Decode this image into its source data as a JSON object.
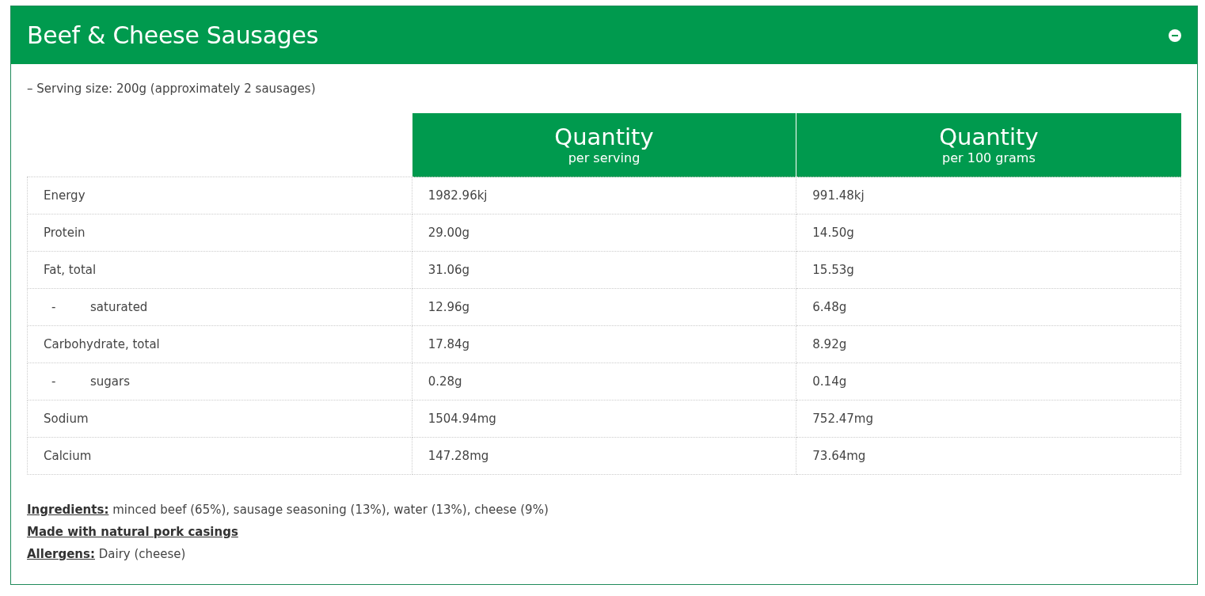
{
  "panel": {
    "title": "Beef & Cheese Sausages",
    "expanded": true
  },
  "serving": "– Serving size: 200g (approximately 2 sausages)",
  "table": {
    "columns": [
      {
        "heading": "Quantity",
        "subheading": "per serving"
      },
      {
        "heading": "Quantity",
        "subheading": "per 100 grams"
      }
    ],
    "rows": [
      {
        "kind": "main",
        "label": "Energy",
        "values": [
          "1982.96kj",
          "991.48kj"
        ]
      },
      {
        "kind": "main",
        "label": "Protein",
        "values": [
          "29.00g",
          "14.50g"
        ]
      },
      {
        "kind": "main",
        "label": "Fat, total",
        "values": [
          "31.06g",
          "15.53g"
        ]
      },
      {
        "kind": "sub",
        "dash": "-",
        "label": "saturated",
        "values": [
          "12.96g",
          "6.48g"
        ]
      },
      {
        "kind": "main",
        "label": "Carbohydrate, total",
        "values": [
          "17.84g",
          "8.92g"
        ]
      },
      {
        "kind": "sub",
        "dash": "-",
        "label": "sugars",
        "values": [
          "0.28g",
          "0.14g"
        ]
      },
      {
        "kind": "main",
        "label": "Sodium",
        "values": [
          "1504.94mg",
          "752.47mg"
        ]
      },
      {
        "kind": "main",
        "label": "Calcium",
        "values": [
          "147.28mg",
          "73.64mg"
        ]
      }
    ]
  },
  "notes": [
    {
      "text": "**Ingredients:** minced beef (65%), sausage seasoning (13%), water (13%), cheese (9%)",
      "bold": false
    },
    {
      "text": "Made with natural pork casings",
      "bold": true
    },
    {
      "text": "**Allergens:** Dairy (cheese)",
      "bold": false
    }
  ]
}
